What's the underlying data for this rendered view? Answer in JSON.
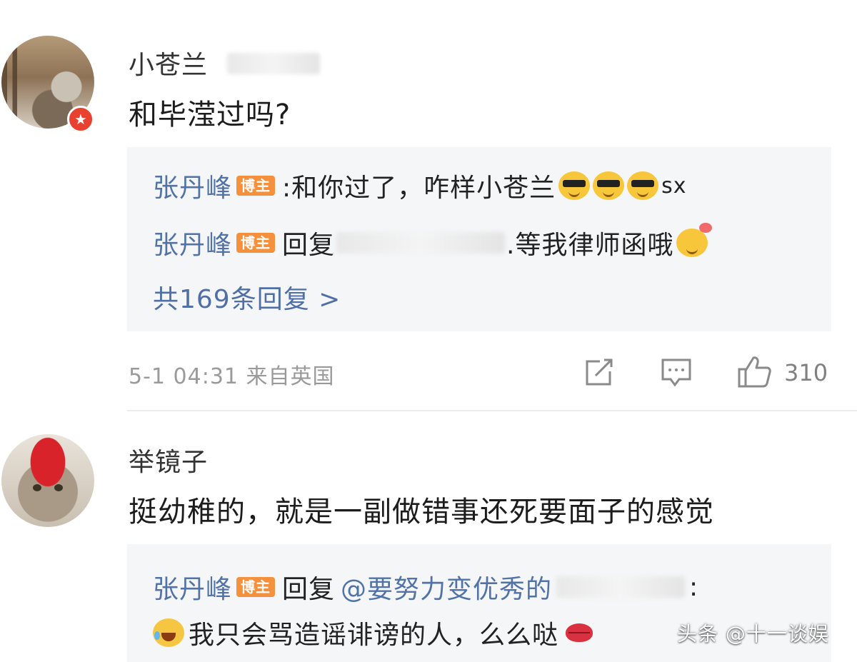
{
  "comments": [
    {
      "username": "小苍兰",
      "content": "和毕滢过吗?",
      "replies": [
        {
          "name": "张丹峰",
          "tag": "博主",
          "text": ":和你过了，咋样小苍兰",
          "emoji": "sunglasses-emoji ×3",
          "suffix": "sx"
        },
        {
          "name": "张丹峰",
          "tag": "博主",
          "prefix": "回复",
          "text": ".等我律师函哦",
          "emoji": "thinking-emoji"
        }
      ],
      "more_replies": "共169条回复 >",
      "timestamp": "5-1 04:31 来自英国",
      "like_count": "310"
    },
    {
      "username": "举镜子",
      "content": "挺幼稚的，就是一副做错事还死要面子的感觉",
      "replies": [
        {
          "name": "张丹峰",
          "tag": "博主",
          "prefix": "回复",
          "mention": "@要努力变优秀的",
          "colon": ":",
          "text": "我只会骂造谣诽谤的人，么么哒",
          "emoji": "laugh-cry-emoji"
        }
      ]
    }
  ],
  "watermark": "头条 @十一谈娱",
  "colors": {
    "link": "#5173a8",
    "tag": "#f5903d",
    "badge": "#e8412f",
    "reply_bg": "#f5f6f8"
  }
}
